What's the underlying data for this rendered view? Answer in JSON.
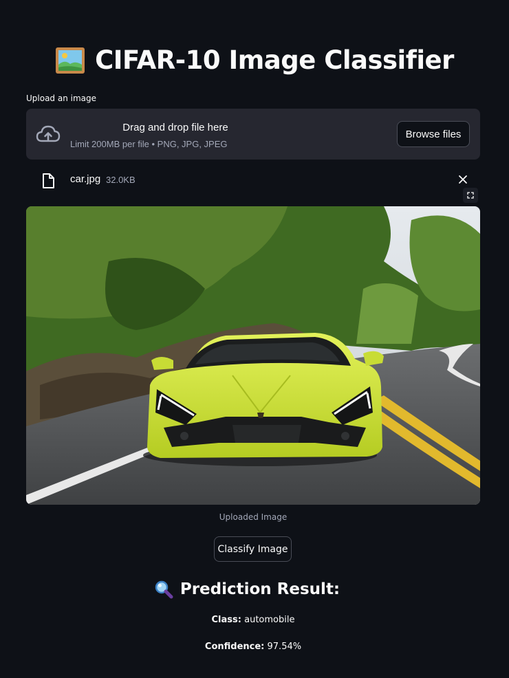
{
  "app": {
    "title": "CIFAR-10 Image Classifier",
    "title_icon": "framed-picture-icon"
  },
  "uploader": {
    "label": "Upload an image",
    "drop_title": "Drag and drop file here",
    "drop_subtitle": "Limit 200MB per file • PNG, JPG, JPEG",
    "browse_label": "Browse files",
    "file": {
      "name": "car.jpg",
      "size": "32.0KB"
    }
  },
  "image": {
    "caption": "Uploaded Image",
    "subject": "lime-green sports car on a winding road"
  },
  "actions": {
    "classify_label": "Classify Image"
  },
  "result": {
    "heading": "Prediction Result:",
    "heading_icon": "magnifier-icon",
    "class_label": "Class:",
    "class_value": "automobile",
    "confidence_label": "Confidence:",
    "confidence_value": "97.54%"
  },
  "colors": {
    "background": "#0e1117",
    "dropzone": "#262730",
    "muted_text": "#a3a8b8",
    "text": "#fafafa"
  }
}
